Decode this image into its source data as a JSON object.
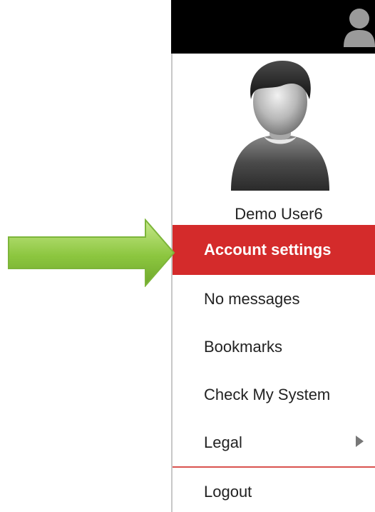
{
  "user": {
    "name": "Demo User6"
  },
  "menu": {
    "items": [
      {
        "label": "Account settings",
        "active": true
      },
      {
        "label": "No messages"
      },
      {
        "label": "Bookmarks"
      },
      {
        "label": "Check My System"
      },
      {
        "label": "Legal",
        "has_submenu": true
      },
      {
        "label": "Logout"
      }
    ]
  },
  "colors": {
    "topbar": "#000000",
    "active_item": "#d42b2b",
    "divider": "#d9534f",
    "pointer_arrow": "#8cc63f"
  },
  "icons": {
    "top": "user-silhouette-icon",
    "avatar": "user-avatar-icon",
    "pointer": "green-arrow-icon",
    "submenu": "caret-right-icon"
  }
}
